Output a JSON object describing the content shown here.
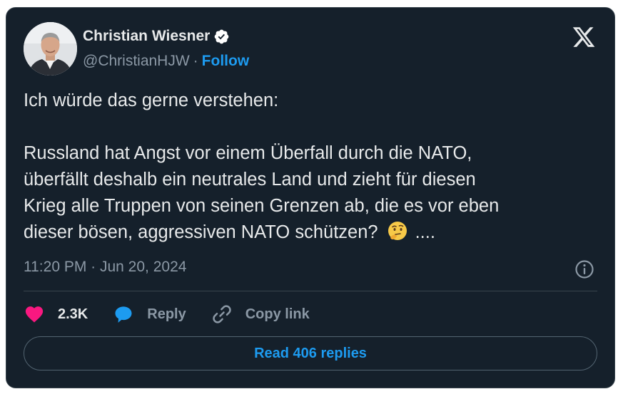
{
  "author": {
    "name": "Christian Wiesner",
    "handle": "@ChristianHJW",
    "separator": "·",
    "follow_label": "Follow",
    "verified": true
  },
  "tweet": {
    "line1": "Ich würde das gerne verstehen:",
    "line2": "Russland hat Angst vor einem Überfall durch die NATO,",
    "line3": "überfällt deshalb ein neutrales Land und zieht für diesen",
    "line4": "Krieg alle Truppen von seinen Grenzen ab, die es vor eben",
    "line5": "dieser bösen, aggressiven NATO schützen?",
    "emoji": "thinking-face",
    "trail": "...."
  },
  "meta": {
    "timestamp": "11:20 PM · Jun 20, 2024"
  },
  "actions": {
    "likes": "2.3K",
    "reply_label": "Reply",
    "copy_label": "Copy link"
  },
  "read_replies_label": "Read 406 replies",
  "colors": {
    "card_bg": "#15202b",
    "accent": "#1d9bf0",
    "like": "#f91880",
    "muted": "#8b98a5"
  }
}
